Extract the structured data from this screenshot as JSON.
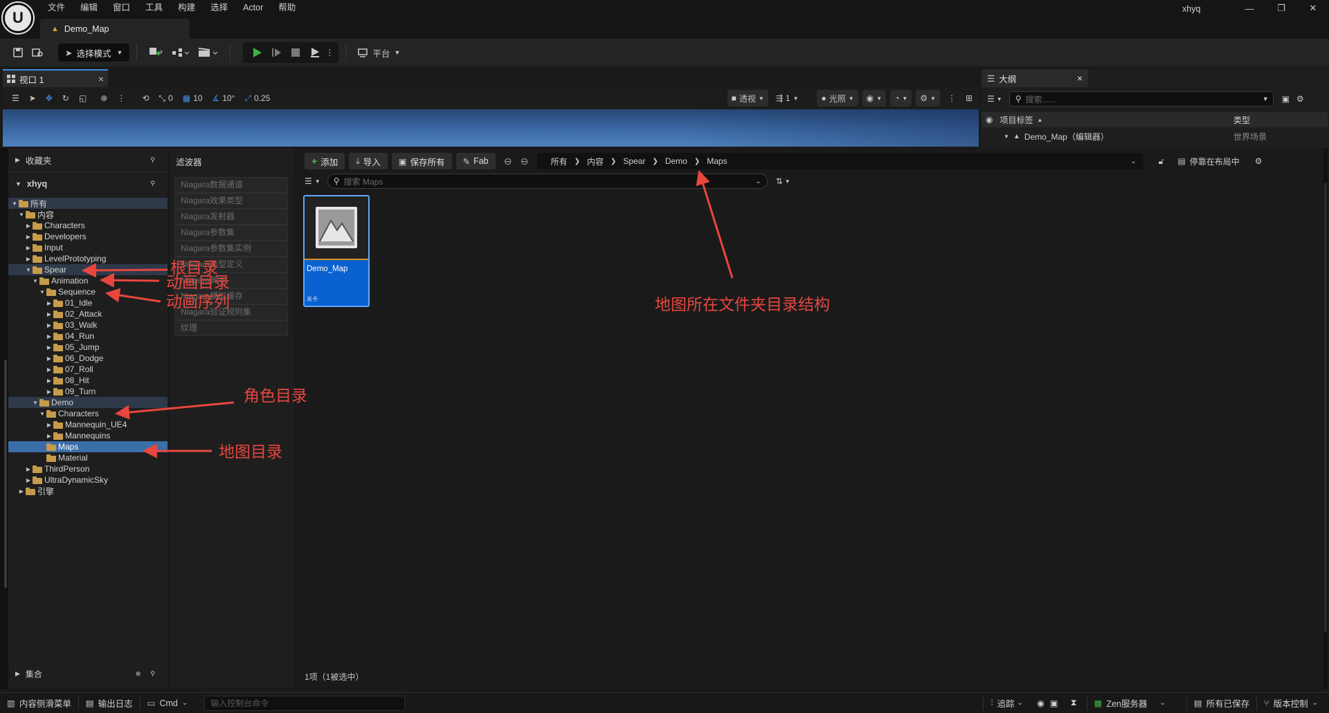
{
  "window": {
    "menu": [
      "文件",
      "编辑",
      "窗口",
      "工具",
      "构建",
      "选择",
      "Actor",
      "帮助"
    ],
    "user": "xhyq",
    "doc_tab": "Demo_Map"
  },
  "main_toolbar": {
    "mode": "选择模式",
    "platform": "平台"
  },
  "viewport": {
    "tab": "视口 1",
    "grid_snap": "0",
    "location_snap": "10",
    "rotation_snap": "10°",
    "scale_snap": "0.25",
    "perspective": "透视",
    "camera_speed": "1",
    "lighting": "光照"
  },
  "outliner": {
    "tab": "大纲",
    "search_placeholder": "搜索......",
    "col_label": "项目标签",
    "col_type": "类型",
    "row_name": "Demo_Map（编辑器）",
    "row_type": "世界场景"
  },
  "sources": {
    "favorites": "收藏夹",
    "root_name": "xhyq",
    "tree": [
      {
        "label": "所有",
        "depth": 0,
        "open": true,
        "state": "hl"
      },
      {
        "label": "内容",
        "depth": 1,
        "open": true,
        "state": ""
      },
      {
        "label": "Characters",
        "depth": 2,
        "open": false,
        "state": ""
      },
      {
        "label": "Developers",
        "depth": 2,
        "open": false,
        "state": ""
      },
      {
        "label": "Input",
        "depth": 2,
        "open": false,
        "state": ""
      },
      {
        "label": "LevelPrototyping",
        "depth": 2,
        "open": false,
        "state": ""
      },
      {
        "label": "Spear",
        "depth": 2,
        "open": true,
        "state": "hl"
      },
      {
        "label": "Animation",
        "depth": 3,
        "open": true,
        "state": ""
      },
      {
        "label": "Sequence",
        "depth": 4,
        "open": true,
        "state": ""
      },
      {
        "label": "01_Idle",
        "depth": 5,
        "open": false,
        "state": ""
      },
      {
        "label": "02_Attack",
        "depth": 5,
        "open": false,
        "state": ""
      },
      {
        "label": "03_Walk",
        "depth": 5,
        "open": false,
        "state": ""
      },
      {
        "label": "04_Run",
        "depth": 5,
        "open": false,
        "state": ""
      },
      {
        "label": "05_Jump",
        "depth": 5,
        "open": false,
        "state": ""
      },
      {
        "label": "06_Dodge",
        "depth": 5,
        "open": false,
        "state": ""
      },
      {
        "label": "07_Roll",
        "depth": 5,
        "open": false,
        "state": ""
      },
      {
        "label": "08_Hit",
        "depth": 5,
        "open": false,
        "state": ""
      },
      {
        "label": "09_Turn",
        "depth": 5,
        "open": false,
        "state": ""
      },
      {
        "label": "Demo",
        "depth": 3,
        "open": true,
        "state": "hl"
      },
      {
        "label": "Characters",
        "depth": 4,
        "open": true,
        "state": ""
      },
      {
        "label": "Mannequin_UE4",
        "depth": 5,
        "open": false,
        "state": ""
      },
      {
        "label": "Mannequins",
        "depth": 5,
        "open": false,
        "state": ""
      },
      {
        "label": "Maps",
        "depth": 4,
        "open": null,
        "state": "sel"
      },
      {
        "label": "Material",
        "depth": 4,
        "open": null,
        "state": ""
      },
      {
        "label": "ThirdPerson",
        "depth": 2,
        "open": false,
        "state": ""
      },
      {
        "label": "UltraDynamicSky",
        "depth": 2,
        "open": false,
        "state": ""
      },
      {
        "label": "引擎",
        "depth": 1,
        "open": false,
        "state": ""
      }
    ],
    "collections": "集合"
  },
  "filters": {
    "title": "滤波器",
    "items": [
      "Niagara数据通道",
      "Niagara效果类型",
      "Niagara发射器",
      "Niagara参数集",
      "Niagara参数集实例",
      "Niagara类型定义",
      "Niagara脚本",
      "Niagara模拟缓存",
      "Niagara验证规则集",
      "纹理"
    ]
  },
  "content": {
    "add": "添加",
    "import": "导入",
    "save_all": "保存所有",
    "fab": "Fab",
    "breadcrumb": [
      "所有",
      "内容",
      "Spear",
      "Demo",
      "Maps"
    ],
    "dock_layout": "停靠在布局中",
    "search_placeholder": "搜索 Maps",
    "asset_name": "Demo_Map",
    "asset_type": "关卡",
    "item_count": "1项（1被选中）"
  },
  "statusbar": {
    "content_drawer": "内容侧滑菜单",
    "output_log": "输出日志",
    "cmd": "Cmd",
    "console_placeholder": "输入控制台命令",
    "trace": "追踪",
    "zen_server": "Zen服务器",
    "all_saved": "所有已保存",
    "source_control": "版本控制"
  },
  "annotations": {
    "root_dir": "根目录",
    "anim_dir": "动画目录",
    "anim_seq": "动画序列",
    "char_dir": "角色目录",
    "map_dir": "地图目录",
    "map_path": "地图所在文件夹目录结构"
  },
  "colors": {
    "annotation": "#e8463e",
    "selection": "#3a6ea8",
    "asset_tile": "#0a62d0",
    "play_green": "#3cb043",
    "folder": "#c69b4a"
  }
}
